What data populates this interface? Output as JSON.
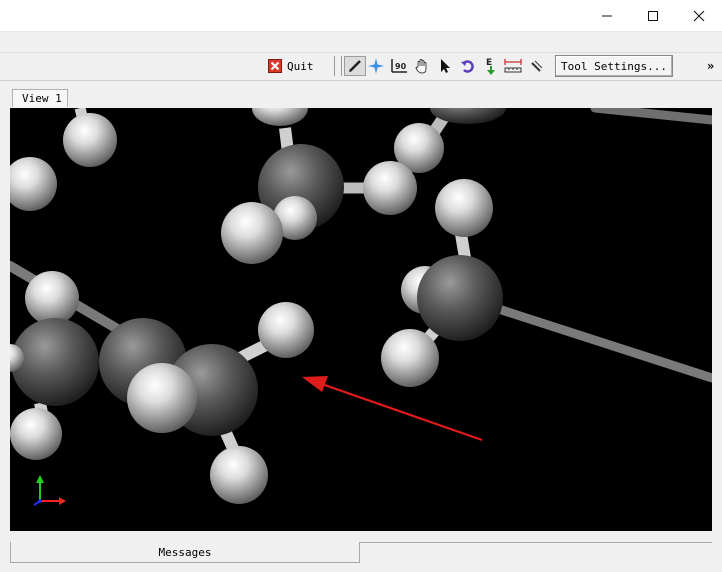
{
  "window": {
    "controls": [
      "minimize-icon",
      "maximize-icon",
      "close-icon"
    ]
  },
  "toolbar": {
    "quit_label": "Quit",
    "tool_settings_label": "Tool Settings...",
    "tools": [
      "pencil-icon",
      "navigate-star-icon",
      "rotate-90-icon",
      "hand-icon",
      "pointer-icon",
      "undo-rotate-icon",
      "extract-icon",
      "measure-icon",
      "ruler-icon"
    ],
    "overflow_label": "»"
  },
  "tabs": {
    "view1_label": "View 1"
  },
  "bottom": {
    "messages_label": "Messages"
  },
  "colors": {
    "viewport_bg": "#000000",
    "arrow": "#e01b1b",
    "axis_x": "#ff2020",
    "axis_y": "#1fd01f",
    "axis_z": "#2030ff"
  }
}
